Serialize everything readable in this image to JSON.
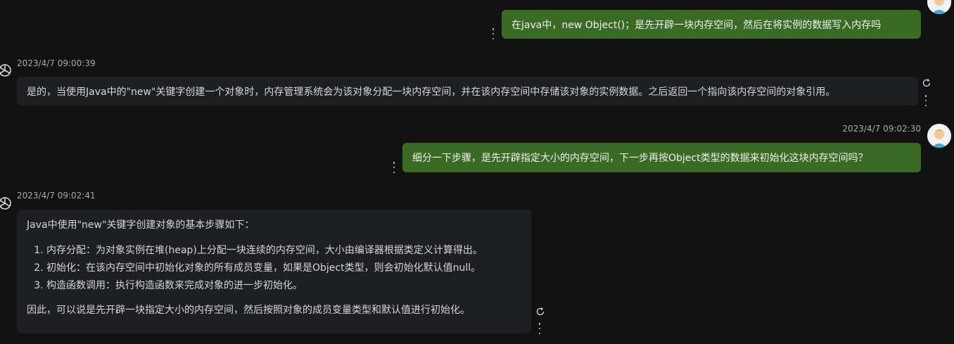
{
  "messages": [
    {
      "role": "user",
      "timestamp": "",
      "text": "在java中，new Object()；是先开辟一块内存空间，然后在将实例的数据写入内存吗"
    },
    {
      "role": "assistant",
      "timestamp": "2023/4/7 09:00:39",
      "text": "是的，当使用Java中的\"new\"关键字创建一个对象时，内存管理系统会为该对象分配一块内存空间，并在该内存空间中存储该对象的实例数据。之后返回一个指向该内存空间的对象引用。"
    },
    {
      "role": "user",
      "timestamp": "2023/4/7 09:02:30",
      "text": "细分一下步骤，是先开辟指定大小的内存空间，下一步再按Object类型的数据来初始化这块内存空间吗？"
    },
    {
      "role": "assistant",
      "timestamp": "2023/4/7 09:02:41",
      "intro": "Java中使用\"new\"关键字创建对象的基本步骤如下：",
      "steps": [
        "内存分配：为对象实例在堆(heap)上分配一块连续的内存空间，大小由编译器根据类定义计算得出。",
        "初始化：在该内存空间中初始化对象的所有成员变量，如果是Object类型，则会初始化默认值null。",
        "构造函数调用：执行构造函数来完成对象的进一步初始化。"
      ],
      "conclusion": "因此，可以说是先开辟一块指定大小的内存空间，然后按照对象的成员变量类型和默认值进行初始化。"
    }
  ],
  "colors": {
    "background": "#111111",
    "user_bubble": "#3a6b25",
    "assistant_bubble": "#1e1f22",
    "timestamp": "#a9a9a9"
  },
  "icons": {
    "user_avatar": "user-avatar-icon",
    "assistant_avatar": "openai-logo-icon",
    "more": "more-vertical-icon",
    "regenerate": "refresh-icon"
  }
}
